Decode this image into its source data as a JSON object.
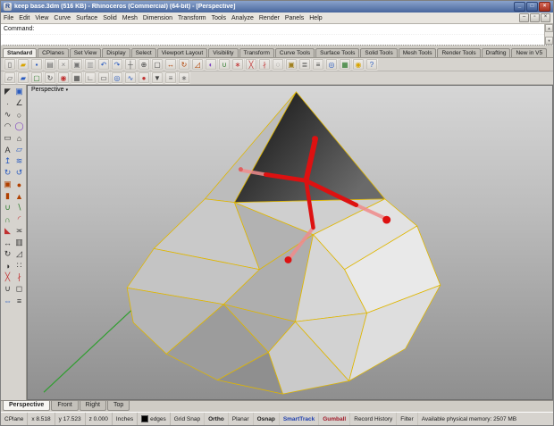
{
  "window": {
    "app_icon": "R",
    "title": "keep base.3dm (516 KB) - Rhinoceros (Commercial) (64-bit) - [Perspective]",
    "buttons": {
      "minimize": "_",
      "maximize": "□",
      "close": "×"
    },
    "doc_buttons": {
      "minimize": "–",
      "restore": "▫",
      "close": "×"
    }
  },
  "menu": {
    "items": [
      {
        "name": "menu-file",
        "label": "File"
      },
      {
        "name": "menu-edit",
        "label": "Edit"
      },
      {
        "name": "menu-view",
        "label": "View"
      },
      {
        "name": "menu-curve",
        "label": "Curve"
      },
      {
        "name": "menu-surface",
        "label": "Surface"
      },
      {
        "name": "menu-solid",
        "label": "Solid"
      },
      {
        "name": "menu-mesh",
        "label": "Mesh"
      },
      {
        "name": "menu-dimension",
        "label": "Dimension"
      },
      {
        "name": "menu-transform",
        "label": "Transform"
      },
      {
        "name": "menu-tools",
        "label": "Tools"
      },
      {
        "name": "menu-analyze",
        "label": "Analyze"
      },
      {
        "name": "menu-render",
        "label": "Render"
      },
      {
        "name": "menu-panels",
        "label": "Panels"
      },
      {
        "name": "menu-help",
        "label": "Help"
      }
    ]
  },
  "command": {
    "lines": [
      "Command:",
      ""
    ],
    "scroll_up": "▲",
    "scroll_down": "▼"
  },
  "toolbar_tabs": {
    "items": [
      {
        "name": "tab-standard",
        "label": "Standard",
        "active": true
      },
      {
        "name": "tab-cplanes",
        "label": "CPlanes"
      },
      {
        "name": "tab-set-view",
        "label": "Set View"
      },
      {
        "name": "tab-display",
        "label": "Display"
      },
      {
        "name": "tab-select",
        "label": "Select"
      },
      {
        "name": "tab-viewport-layout",
        "label": "Viewport Layout"
      },
      {
        "name": "tab-visibility",
        "label": "Visibility"
      },
      {
        "name": "tab-transform",
        "label": "Transform"
      },
      {
        "name": "tab-curve-tools",
        "label": "Curve Tools"
      },
      {
        "name": "tab-surface-tools",
        "label": "Surface Tools"
      },
      {
        "name": "tab-solid-tools",
        "label": "Solid Tools"
      },
      {
        "name": "tab-mesh-tools",
        "label": "Mesh Tools"
      },
      {
        "name": "tab-render-tools",
        "label": "Render Tools"
      },
      {
        "name": "tab-drafting",
        "label": "Drafting"
      },
      {
        "name": "tab-new-in-v5",
        "label": "New in V5"
      }
    ]
  },
  "toolbar_main": {
    "icons": [
      {
        "name": "new-file-icon",
        "glyph": "▯",
        "color": "#555555"
      },
      {
        "name": "open-file-icon",
        "glyph": "▰",
        "color": "#d8a400"
      },
      {
        "name": "save-file-icon",
        "glyph": "▪",
        "color": "#2a5bbf"
      },
      {
        "name": "print-icon",
        "glyph": "▤",
        "color": "#666666"
      },
      {
        "name": "cut-icon",
        "glyph": "×",
        "color": "#888888"
      },
      {
        "name": "copy-icon",
        "glyph": "▣",
        "color": "#777777"
      },
      {
        "name": "paste-icon",
        "glyph": "▥",
        "color": "#999999"
      },
      {
        "name": "undo-icon",
        "glyph": "↶",
        "color": "#2a5bbf"
      },
      {
        "name": "redo-icon",
        "glyph": "↷",
        "color": "#2a5bbf"
      },
      {
        "name": "pan-icon",
        "glyph": "┼",
        "color": "#444444"
      },
      {
        "name": "zoom-icon",
        "glyph": "⊕",
        "color": "#444444"
      },
      {
        "name": "zoom-extents-icon",
        "glyph": "▢",
        "color": "#444444"
      },
      {
        "name": "move-icon",
        "glyph": "↔",
        "color": "#b04000"
      },
      {
        "name": "rotate-icon",
        "glyph": "↻",
        "color": "#b04000"
      },
      {
        "name": "scale-icon",
        "glyph": "◿",
        "color": "#b04000"
      },
      {
        "name": "mirror-icon",
        "glyph": "◐",
        "color": "#7a3fbf"
      },
      {
        "name": "join-icon",
        "glyph": "∪",
        "color": "#2a7a2a"
      },
      {
        "name": "explode-icon",
        "glyph": "∗",
        "color": "#c03030"
      },
      {
        "name": "trim-icon",
        "glyph": "╳",
        "color": "#c03030"
      },
      {
        "name": "split-icon",
        "glyph": "∤",
        "color": "#c03030"
      },
      {
        "name": "hide-icon",
        "glyph": "◌",
        "color": "#666666"
      },
      {
        "name": "lock-icon",
        "glyph": "▣",
        "color": "#a08020"
      },
      {
        "name": "layers-icon",
        "glyph": "≣",
        "color": "#444444"
      },
      {
        "name": "properties-icon",
        "glyph": "≡",
        "color": "#444444"
      },
      {
        "name": "osnap-icon",
        "glyph": "◎",
        "color": "#2a5bbf"
      },
      {
        "name": "grid-icon",
        "glyph": "▦",
        "color": "#2a7a2a"
      },
      {
        "name": "render-icon",
        "glyph": "◉",
        "color": "#d8a400"
      },
      {
        "name": "help-icon",
        "glyph": "?",
        "color": "#2a5bbf"
      }
    ]
  },
  "toolbar_secondary": {
    "icons": [
      {
        "name": "cplane-world-icon",
        "glyph": "▱",
        "color": "#444444"
      },
      {
        "name": "cplane-object-icon",
        "glyph": "▰",
        "color": "#2a5bbf"
      },
      {
        "name": "cplane-view-icon",
        "glyph": "▢",
        "color": "#2a7a2a"
      },
      {
        "name": "cplane-rotate-icon",
        "glyph": "↻",
        "color": "#444444"
      },
      {
        "name": "gumball-icon",
        "glyph": "◉",
        "color": "#c03030"
      },
      {
        "name": "grid-snap-icon",
        "glyph": "▦",
        "color": "#444444"
      },
      {
        "name": "ortho-icon",
        "glyph": "∟",
        "color": "#444444"
      },
      {
        "name": "planar-icon",
        "glyph": "▭",
        "color": "#444444"
      },
      {
        "name": "osnap-settings-icon",
        "glyph": "◎",
        "color": "#2a5bbf"
      },
      {
        "name": "smarttrack-icon",
        "glyph": "∿",
        "color": "#2a5bbf"
      },
      {
        "name": "record-history-icon",
        "glyph": "●",
        "color": "#c03030"
      },
      {
        "name": "filter-icon",
        "glyph": "▼",
        "color": "#444444"
      },
      {
        "name": "units-icon",
        "glyph": "≡",
        "color": "#666666"
      },
      {
        "name": "options-icon",
        "glyph": "∗",
        "color": "#666666"
      }
    ]
  },
  "sidebar": {
    "icons": [
      {
        "name": "select-pointer-icon",
        "glyph": "◤",
        "color": "#333333"
      },
      {
        "name": "selection-filter-icon",
        "glyph": "▣",
        "color": "#2a5bbf"
      },
      {
        "name": "point-icon",
        "glyph": "∙",
        "color": "#333333"
      },
      {
        "name": "polyline-icon",
        "glyph": "∠",
        "color": "#333333"
      },
      {
        "name": "curve-icon",
        "glyph": "∿",
        "color": "#333333"
      },
      {
        "name": "circle-icon",
        "glyph": "○",
        "color": "#333333"
      },
      {
        "name": "arc-icon",
        "glyph": "◠",
        "color": "#333333"
      },
      {
        "name": "ellipse-icon",
        "glyph": "◯",
        "color": "#7a3fbf"
      },
      {
        "name": "rectangle-icon",
        "glyph": "▭",
        "color": "#333333"
      },
      {
        "name": "polygon-icon",
        "glyph": "⌂",
        "color": "#333333"
      },
      {
        "name": "text-icon",
        "glyph": "A",
        "color": "#333333"
      },
      {
        "name": "surface-plane-icon",
        "glyph": "▱",
        "color": "#2a5bbf"
      },
      {
        "name": "extrude-icon",
        "glyph": "↥",
        "color": "#2a5bbf"
      },
      {
        "name": "loft-icon",
        "glyph": "≋",
        "color": "#2a5bbf"
      },
      {
        "name": "revolve-icon",
        "glyph": "↻",
        "color": "#2a5bbf"
      },
      {
        "name": "sweep-icon",
        "glyph": "↺",
        "color": "#2a5bbf"
      },
      {
        "name": "box-icon",
        "glyph": "▣",
        "color": "#b04000"
      },
      {
        "name": "sphere-icon",
        "glyph": "●",
        "color": "#b04000"
      },
      {
        "name": "cylinder-icon",
        "glyph": "▮",
        "color": "#b04000"
      },
      {
        "name": "cone-icon",
        "glyph": "▲",
        "color": "#b04000"
      },
      {
        "name": "boolean-union-icon",
        "glyph": "∪",
        "color": "#2a7a2a"
      },
      {
        "name": "boolean-difference-icon",
        "glyph": "∖",
        "color": "#2a7a2a"
      },
      {
        "name": "boolean-intersection-icon",
        "glyph": "∩",
        "color": "#2a7a2a"
      },
      {
        "name": "fillet-icon",
        "glyph": "◜",
        "color": "#c03030"
      },
      {
        "name": "chamfer-icon",
        "glyph": "◣",
        "color": "#c03030"
      },
      {
        "name": "offset-icon",
        "glyph": "≍",
        "color": "#333333"
      },
      {
        "name": "move-tool-icon",
        "glyph": "↔",
        "color": "#333333"
      },
      {
        "name": "copy-tool-icon",
        "glyph": "▥",
        "color": "#333333"
      },
      {
        "name": "rotate-tool-icon",
        "glyph": "↻",
        "color": "#333333"
      },
      {
        "name": "scale-tool-icon",
        "glyph": "◿",
        "color": "#333333"
      },
      {
        "name": "mirror-tool-icon",
        "glyph": "◑",
        "color": "#333333"
      },
      {
        "name": "array-icon",
        "glyph": "∷",
        "color": "#333333"
      },
      {
        "name": "trim-tool-icon",
        "glyph": "╳",
        "color": "#c03030"
      },
      {
        "name": "split-tool-icon",
        "glyph": "∤",
        "color": "#c03030"
      },
      {
        "name": "join-tool-icon",
        "glyph": "∪",
        "color": "#333333"
      },
      {
        "name": "group-icon",
        "glyph": "◻",
        "color": "#333333"
      },
      {
        "name": "dimension-icon",
        "glyph": "⇔",
        "color": "#2a5bbf"
      },
      {
        "name": "measure-icon",
        "glyph": "≡",
        "color": "#333333"
      }
    ]
  },
  "viewport": {
    "label": "Perspective",
    "menu_arrow": "▾"
  },
  "viewport_tabs": {
    "items": [
      {
        "name": "viewport-tab-perspective",
        "label": "Perspective",
        "active": true
      },
      {
        "name": "viewport-tab-front",
        "label": "Front"
      },
      {
        "name": "viewport-tab-right",
        "label": "Right"
      },
      {
        "name": "viewport-tab-top",
        "label": "Top"
      }
    ]
  },
  "status": {
    "cplane": "CPlane",
    "x": "x 8.518",
    "y": "y 17.523",
    "z": "z 0.000",
    "units": "Inches",
    "layer": {
      "name": "edges",
      "color": "#000000"
    },
    "toggles": [
      {
        "name": "toggle-grid-snap",
        "label": "Grid Snap",
        "active": false
      },
      {
        "name": "toggle-ortho",
        "label": "Ortho",
        "active": true
      },
      {
        "name": "toggle-planar",
        "label": "Planar",
        "active": false
      },
      {
        "name": "toggle-osnap",
        "label": "Osnap",
        "active": true
      },
      {
        "name": "toggle-smarttrack",
        "label": "SmartTrack",
        "active": true,
        "text_color": "#1f3fae"
      },
      {
        "name": "toggle-gumball",
        "label": "Gumball",
        "active": true,
        "text_color": "#a01828"
      },
      {
        "name": "toggle-record-history",
        "label": "Record History",
        "active": false
      },
      {
        "name": "toggle-filter",
        "label": "Filter",
        "active": false
      }
    ],
    "memory": "Available physical memory: 2507 MB"
  },
  "colors": {
    "selection_edge_yellow": "#dfb600",
    "pipe_red": "#dd1111",
    "pipe_pink": "#f08c8c",
    "axis_green": "#2f9e2f",
    "titlebar_blue": "#49679d",
    "viewport_top": "#d6d6d6",
    "viewport_bottom": "#8f8f8f"
  }
}
